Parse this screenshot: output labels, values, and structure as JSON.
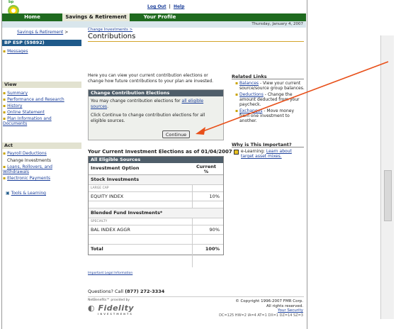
{
  "header": {
    "brand": "bp",
    "logout": "Log Out",
    "separator": "|",
    "help": "Help"
  },
  "nav": {
    "tabs": [
      "Home",
      "Savings & Retirement",
      "Your Profile"
    ],
    "date": "Thursday, January 4, 2007"
  },
  "sidebar": {
    "breadcrumb": "Savings & Retirement",
    "breadcrumb_arrow": ">",
    "plan": "BP ESP (59892)",
    "messages": "Messages",
    "view_heading": "View",
    "view_items": [
      "Summary",
      "Performance and Research",
      "History",
      "Online Statement",
      "Plan Information and Documents"
    ],
    "act_heading": "Act",
    "act_items": [
      "Payroll Deductions",
      "Change Investments",
      "Loans, Rollovers, and Withdrawals",
      "Electronic Payments"
    ],
    "tools": "Tools & Learning"
  },
  "content": {
    "breadcrumb": "Change Investments >",
    "title": "Contributions",
    "intro": "Here you can view your current contribution elections or change how future contributions to your plan are invested.",
    "box": {
      "heading": "Change Contribution Elections",
      "p1_pre": "You may change contribution elections for ",
      "p1_link": "all eligible sources",
      "p1_post": ".",
      "p2": "Click Continue to change contribution elections for all eligible sources.",
      "button": "Continue"
    },
    "elections": {
      "title": "Your Current Investment Elections as of 01/04/2007",
      "source": "All Eligible Sources",
      "col1": "Investment Option",
      "col2": "Current %",
      "group1": "Stock Investments",
      "sub1": "LARGE CAP",
      "fund1": "EQUITY INDEX",
      "pct1": "10%",
      "group2": "Blended Fund Investments*",
      "sub2": "SPECIALTY",
      "fund2": "BAL INDEX AGGR",
      "pct2": "90%",
      "total_label": "Total",
      "total_value": "100%"
    },
    "legal": "Important Legal Information",
    "questions_pre": "Questions? Call",
    "phone": "(877) 272-3334",
    "netbenefits": "NetBenefits℠ provided by",
    "fidelity": "Fidelity",
    "fidelity_sub": "INVESTMENTS",
    "copyright": "© Copyright 1996-2007 FMR Corp.",
    "rights": "All rights reserved.",
    "security": "Your Security",
    "dc_code": "DC=125 HW=2 IA=4 AT=1 DX=1 DZ=14 SZ=3"
  },
  "related": {
    "title": "Related Links",
    "items": [
      {
        "link": "Balances",
        "text": " - View your current source/source group balances."
      },
      {
        "link": "Deductions",
        "text": " - Change the amount deducted from your paycheck."
      },
      {
        "link": "Exchanges",
        "text": " - Move money from one investment to another."
      }
    ],
    "why_title": "Why is This Important?",
    "why_pre": "e-Learning: ",
    "why_link": "Learn about target asset mixes."
  },
  "colors": {
    "nav_green": "#1f6a1f",
    "box_header": "#4f5e6a",
    "accent_gold": "#d3a52a",
    "arrow": "#e8501a"
  }
}
